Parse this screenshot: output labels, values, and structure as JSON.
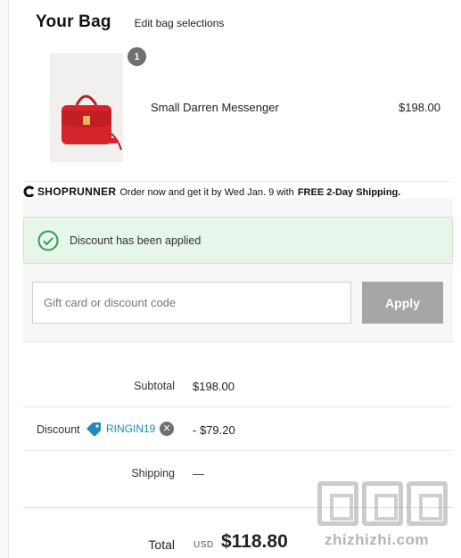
{
  "bag": {
    "title": "Your Bag",
    "edit_link": "Edit bag selections"
  },
  "items": [
    {
      "quantity": "1",
      "name": "Small Darren Messenger",
      "price": "$198.00",
      "image_icon": "red-messenger-bag-image"
    }
  ],
  "shoprunner": {
    "logo": "SHOPRUNNER",
    "message": "Order now and get it by Wed Jan. 9 with",
    "free_text": "FREE 2-Day Shipping."
  },
  "promo": {
    "success_message": "Discount has been applied",
    "input_value": "",
    "input_placeholder": "Gift card or discount code",
    "apply_label": "Apply"
  },
  "summary": {
    "subtotal_label": "Subtotal",
    "subtotal_value": "$198.00",
    "discount_label": "Discount",
    "discount_code": "RINGIN19",
    "discount_value": "- $79.20",
    "shipping_label": "Shipping",
    "shipping_value": "—",
    "total_label": "Total",
    "total_currency": "USD",
    "total_value": "$118.80"
  },
  "watermark": {
    "text": "zhizhizhi.com"
  },
  "colors": {
    "success_bg": "#e7f5ea",
    "success_icon": "#2e9e4f",
    "discount_code": "#1d8bb3",
    "apply_button": "#a6a6a6",
    "qty_badge": "#6f6f6f"
  }
}
